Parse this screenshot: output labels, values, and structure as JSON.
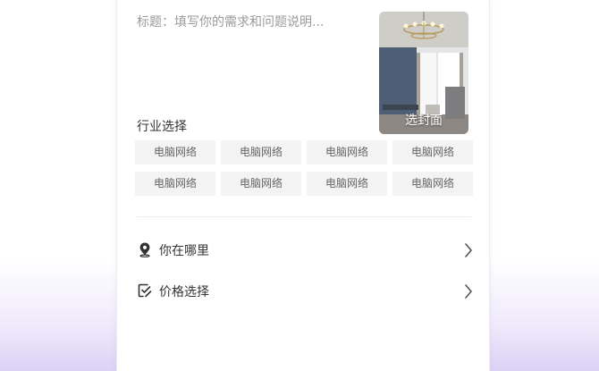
{
  "form": {
    "title_placeholder": "标题：填写你的需求和问题说明...",
    "cover_label": "选封面",
    "industry_label": "行业选择",
    "industry_tags": [
      "电脑网络",
      "电脑网络",
      "电脑网络",
      "电脑网络",
      "电脑网络",
      "电脑网络",
      "电脑网络",
      "电脑网络"
    ],
    "location_label": "你在哪里",
    "price_label": "价格选择"
  },
  "icons": {
    "location": "location-pin-icon",
    "price": "price-tag-edit-icon",
    "chevron": "chevron-right-icon"
  },
  "colors": {
    "tag_bg": "#f3f3f3",
    "tag_text": "#666666",
    "placeholder_text": "#9a9a9a"
  }
}
